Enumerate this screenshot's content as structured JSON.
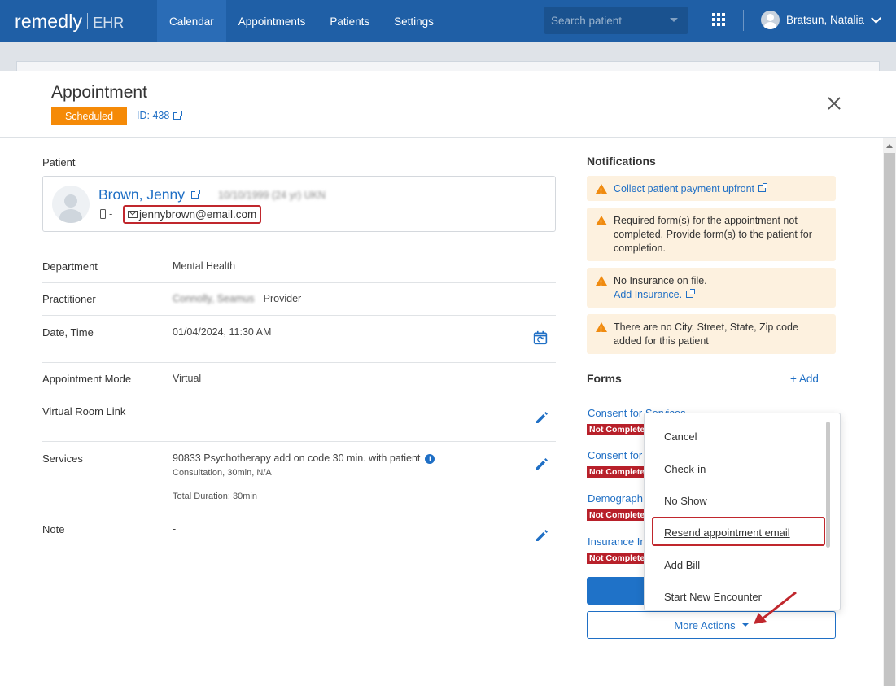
{
  "nav": {
    "brand": "remedly",
    "product": "EHR",
    "items": [
      {
        "label": "Calendar",
        "active": true
      },
      {
        "label": "Appointments",
        "active": false
      },
      {
        "label": "Patients",
        "active": false
      },
      {
        "label": "Settings",
        "active": false
      }
    ],
    "search_placeholder": "Search patient",
    "user_name": "Bratsun, Natalia"
  },
  "modal": {
    "title": "Appointment",
    "status": "Scheduled",
    "id_label": "ID: 438"
  },
  "patient": {
    "section_label": "Patient",
    "name": "Brown, Jenny",
    "dob": "10/10/1999 (24 yr) UKN",
    "phone": "-",
    "email": "jennybrown@email.com"
  },
  "details": {
    "department_label": "Department",
    "department": "Mental Health",
    "practitioner_label": "Practitioner",
    "practitioner_name": "Connolly, Seamus",
    "practitioner_role": "- Provider",
    "datetime_label": "Date, Time",
    "datetime": "01/04/2024, 11:30 AM",
    "mode_label": "Appointment Mode",
    "mode": "Virtual",
    "room_label": "Virtual Room Link",
    "services_label": "Services",
    "service_name": "90833 Psychotherapy add on code 30 min. with patient",
    "service_sub": "Consultation, 30min, N/A",
    "total_duration": "Total Duration: 30min",
    "note_label": "Note",
    "note": "-"
  },
  "notifications": {
    "title": "Notifications",
    "items": [
      {
        "link": "Collect patient payment upfront"
      },
      {
        "text": "Required form(s) for the appointment not completed. Provide form(s) to the patient for completion."
      },
      {
        "text": "No Insurance on file.",
        "link": "Add Insurance."
      },
      {
        "text": "There are no City, Street, State, Zip code added for this patient"
      }
    ]
  },
  "forms": {
    "title": "Forms",
    "add_label": "+  Add",
    "items": [
      {
        "name": "Consent for Services",
        "status": "Not Complete"
      },
      {
        "name": "Consent for",
        "status": "Not Complete"
      },
      {
        "name": "Demograph",
        "status": "Not Complete"
      },
      {
        "name": "Insurance In",
        "status": "Not Complete"
      }
    ]
  },
  "actions": {
    "more_label": "More Actions",
    "menu": [
      "Cancel",
      "Check-in",
      "No Show",
      "Resend appointment email",
      "Add Bill",
      "Start New Encounter"
    ]
  },
  "colors": {
    "nav_bg": "#1f5fa6",
    "accent": "#1f6fc5",
    "status_orange": "#f58a07",
    "highlight_red": "#c0272d",
    "not_complete_red": "#b8202a",
    "notice_bg": "#fdf1df"
  }
}
